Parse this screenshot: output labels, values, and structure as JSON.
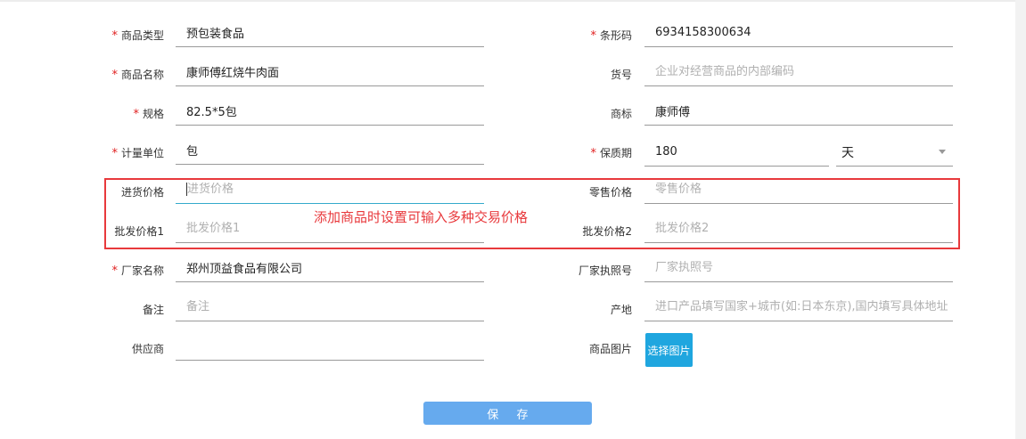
{
  "form": {
    "left": [
      {
        "label": "商品类型",
        "required": true,
        "value": "预包装食品",
        "placeholder": ""
      },
      {
        "label": "商品名称",
        "required": true,
        "value": "康师傅红烧牛肉面",
        "placeholder": ""
      },
      {
        "label": "规格",
        "required": true,
        "value": "82.5*5包",
        "placeholder": ""
      },
      {
        "label": "计量单位",
        "required": true,
        "value": "包",
        "placeholder": ""
      },
      {
        "label": "进货价格",
        "required": false,
        "value": "",
        "placeholder": "进货价格"
      },
      {
        "label": "批发价格1",
        "required": false,
        "value": "",
        "placeholder": "批发价格1"
      },
      {
        "label": "厂家名称",
        "required": true,
        "value": "郑州顶益食品有限公司",
        "placeholder": ""
      },
      {
        "label": "备注",
        "required": false,
        "value": "",
        "placeholder": "备注"
      },
      {
        "label": "供应商",
        "required": false,
        "value": "",
        "placeholder": ""
      }
    ],
    "right": [
      {
        "label": "条形码",
        "required": true,
        "value": "6934158300634",
        "placeholder": ""
      },
      {
        "label": "货号",
        "required": false,
        "value": "",
        "placeholder": "企业对经营商品的内部编码"
      },
      {
        "label": "商标",
        "required": false,
        "value": "康师傅",
        "placeholder": ""
      },
      {
        "label": "保质期",
        "required": true,
        "value": "180",
        "placeholder": "",
        "unit": "天"
      },
      {
        "label": "零售价格",
        "required": false,
        "value": "",
        "placeholder": "零售价格"
      },
      {
        "label": "批发价格2",
        "required": false,
        "value": "",
        "placeholder": "批发价格2"
      },
      {
        "label": "厂家执照号",
        "required": false,
        "value": "",
        "placeholder": "厂家执照号"
      },
      {
        "label": "产地",
        "required": false,
        "value": "",
        "placeholder": "进口产品填写国家+城市(如:日本东京),国内填写具体地址"
      },
      {
        "label": "商品图片",
        "required": false,
        "button": "选择图片"
      }
    ],
    "required_mark": "*"
  },
  "annotation": "添加商品时设置可输入多种交易价格",
  "save_label": "保 存",
  "colors": {
    "required": "#e02020",
    "annotation": "#e8393c",
    "pick_button": "#1fa6df",
    "save_button": "#66aaee"
  }
}
